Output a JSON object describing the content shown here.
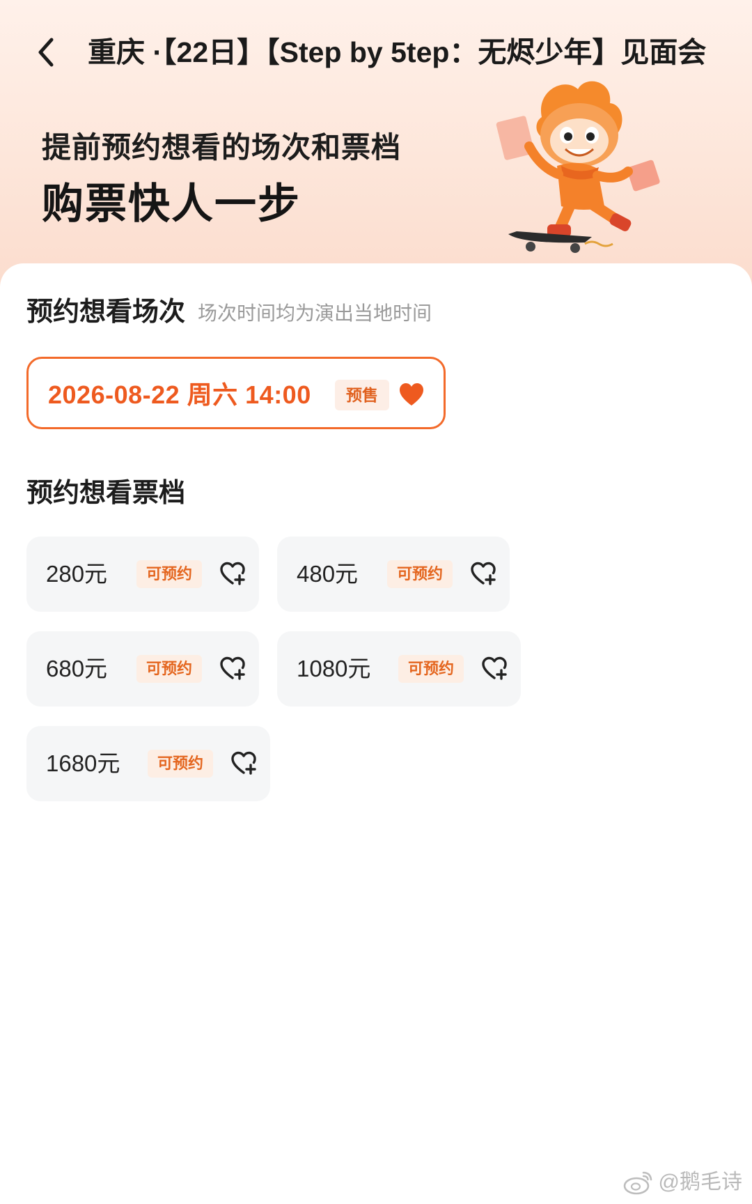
{
  "header": {
    "title": "重庆 ·【22日】【Step by 5tep：无烬少年】见面会",
    "back_icon": "chevron-left-icon"
  },
  "promo": {
    "line1": "提前预约想看的场次和票档",
    "line2": "购票快人一步",
    "mascot_icon": "skateboard-mascot-icon"
  },
  "sessions": {
    "title": "预约想看场次",
    "hint": "场次时间均为演出当地时间",
    "items": [
      {
        "date_label": "2026-08-22 周六 14:00",
        "badge": "预售",
        "selected": true
      }
    ]
  },
  "tiers": {
    "title": "预约想看票档",
    "items": [
      {
        "price": "280元",
        "status": "可预约"
      },
      {
        "price": "480元",
        "status": "可预约"
      },
      {
        "price": "680元",
        "status": "可预约"
      },
      {
        "price": "1080元",
        "status": "可预约"
      },
      {
        "price": "1680元",
        "status": "可预约"
      }
    ]
  },
  "watermark": {
    "text": "@鹅毛诗",
    "icon": "weibo-icon"
  },
  "colors": {
    "accent": "#EE5A1F",
    "badge_bg": "#FDEEE6",
    "card_bg": "#F5F6F7",
    "hero_bg": "#FDE6DA"
  }
}
